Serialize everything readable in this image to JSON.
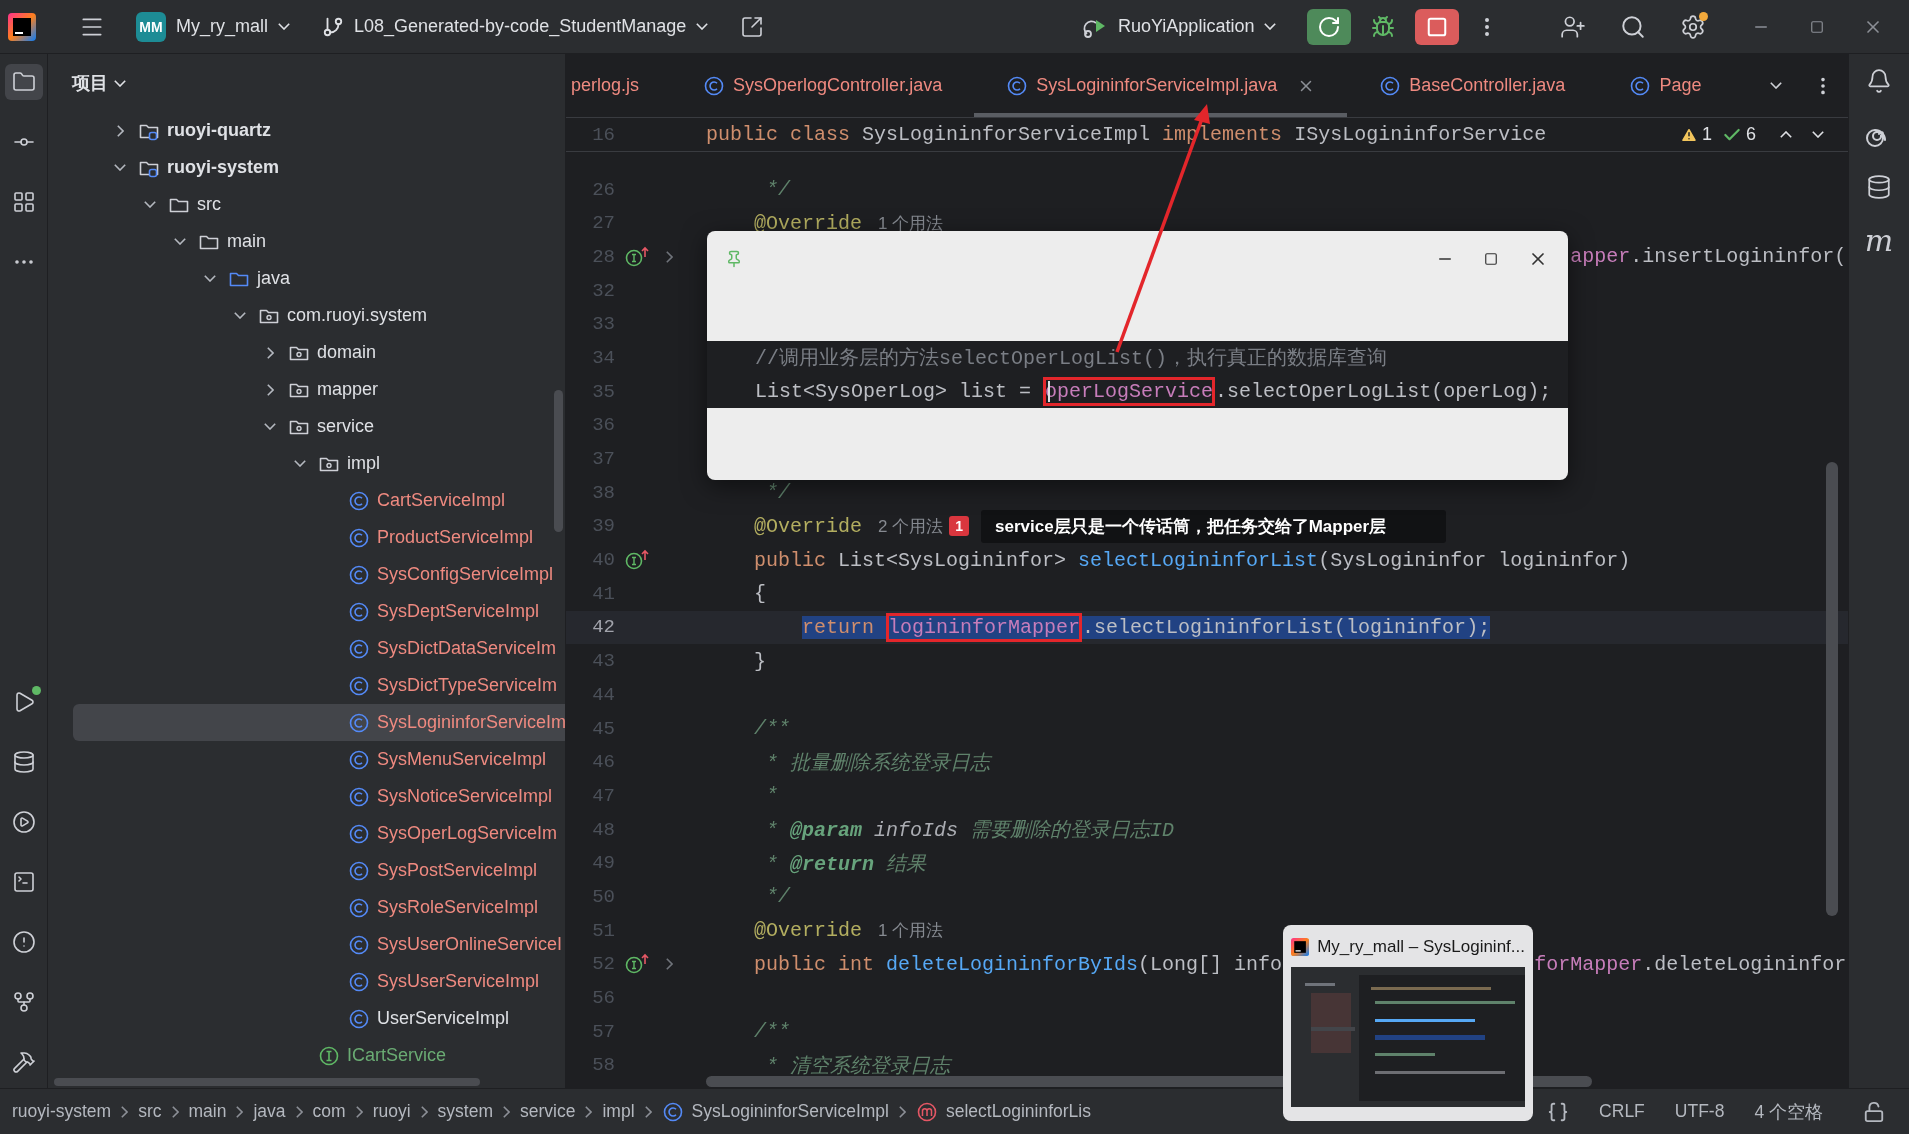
{
  "toolbar": {
    "project_badge": "MM",
    "project": "My_ry_mall",
    "branch": "L08_Generated-by-code_StudentManage",
    "run_config": "RuoYiApplication"
  },
  "left_toolbar": {
    "top": [
      {
        "kind": "project",
        "selected": true,
        "badge": false
      },
      {
        "kind": "commit",
        "selected": false,
        "badge": false
      },
      {
        "kind": "structure",
        "selected": false,
        "badge": false
      },
      {
        "kind": "more",
        "selected": false,
        "badge": false
      }
    ],
    "bottom": [
      {
        "kind": "run",
        "selected": false,
        "badge": true
      },
      {
        "kind": "database",
        "selected": false,
        "badge": false
      },
      {
        "kind": "services",
        "selected": false,
        "badge": false
      },
      {
        "kind": "terminal",
        "selected": false,
        "badge": false
      },
      {
        "kind": "problems",
        "selected": false,
        "badge": false
      },
      {
        "kind": "git",
        "selected": false,
        "badge": false
      },
      {
        "kind": "build",
        "selected": false,
        "badge": false
      }
    ]
  },
  "project_panel": {
    "title": "项目",
    "tree": [
      {
        "label": "ruoyi-quartz",
        "kind": "module",
        "expanded": false,
        "selected": false,
        "color": "#dfe1e5"
      },
      {
        "label": "ruoyi-system",
        "kind": "module",
        "expanded": true,
        "selected": false,
        "color": "#dfe1e5",
        "children": [
          {
            "label": "src",
            "kind": "folder",
            "expanded": true,
            "selected": false,
            "color": "#dfe1e5",
            "children": [
              {
                "label": "main",
                "kind": "folder",
                "expanded": true,
                "selected": false,
                "color": "#dfe1e5",
                "children": [
                  {
                    "label": "java",
                    "kind": "source",
                    "expanded": true,
                    "selected": false,
                    "color": "#dfe1e5",
                    "children": [
                      {
                        "label": "com.ruoyi.system",
                        "kind": "package",
                        "expanded": true,
                        "selected": false,
                        "color": "#dfe1e5",
                        "children": [
                          {
                            "label": "domain",
                            "kind": "package",
                            "expanded": false,
                            "selected": false,
                            "color": "#dfe1e5"
                          },
                          {
                            "label": "mapper",
                            "kind": "package",
                            "expanded": false,
                            "selected": false,
                            "color": "#dfe1e5"
                          },
                          {
                            "label": "service",
                            "kind": "package",
                            "expanded": true,
                            "selected": false,
                            "color": "#dfe1e5",
                            "children": [
                              {
                                "label": "impl",
                                "kind": "package",
                                "expanded": true,
                                "selected": false,
                                "color": "#dfe1e5",
                                "children": [
                                  {
                                    "label": "CartServiceImpl",
                                    "kind": "class",
                                    "selected": false,
                                    "color": "#ef8a80"
                                  },
                                  {
                                    "label": "ProductServiceImpl",
                                    "kind": "class",
                                    "selected": false,
                                    "color": "#ef8a80"
                                  },
                                  {
                                    "label": "SysConfigServiceImpl",
                                    "kind": "class",
                                    "selected": false,
                                    "color": "#ef8a80"
                                  },
                                  {
                                    "label": "SysDeptServiceImpl",
                                    "kind": "class",
                                    "selected": false,
                                    "color": "#ef8a80"
                                  },
                                  {
                                    "label": "SysDictDataServiceIm",
                                    "kind": "class",
                                    "selected": false,
                                    "color": "#ef8a80"
                                  },
                                  {
                                    "label": "SysDictTypeServiceIm",
                                    "kind": "class",
                                    "selected": false,
                                    "color": "#ef8a80"
                                  },
                                  {
                                    "label": "SysLogininforServiceIm",
                                    "kind": "class",
                                    "selected": true,
                                    "color": "#ef8a80"
                                  },
                                  {
                                    "label": "SysMenuServiceImpl",
                                    "kind": "class",
                                    "selected": false,
                                    "color": "#ef8a80"
                                  },
                                  {
                                    "label": "SysNoticeServiceImpl",
                                    "kind": "class",
                                    "selected": false,
                                    "color": "#ef8a80"
                                  },
                                  {
                                    "label": "SysOperLogServiceIm",
                                    "kind": "class",
                                    "selected": false,
                                    "color": "#ef8a80"
                                  },
                                  {
                                    "label": "SysPostServiceImpl",
                                    "kind": "class",
                                    "selected": false,
                                    "color": "#ef8a80"
                                  },
                                  {
                                    "label": "SysRoleServiceImpl",
                                    "kind": "class",
                                    "selected": false,
                                    "color": "#ef8a80"
                                  },
                                  {
                                    "label": "SysUserOnlineServiceI",
                                    "kind": "class",
                                    "selected": false,
                                    "color": "#ef8a80"
                                  },
                                  {
                                    "label": "SysUserServiceImpl",
                                    "kind": "class",
                                    "selected": false,
                                    "color": "#ef8a80"
                                  },
                                  {
                                    "label": "UserServiceImpl",
                                    "kind": "class",
                                    "selected": false,
                                    "color": "#dfe1e5"
                                  }
                                ]
                              },
                              {
                                "label": "ICartService",
                                "kind": "interface",
                                "selected": false,
                                "color": "#6aab73"
                              }
                            ]
                          }
                        ]
                      }
                    ]
                  }
                ]
              }
            ]
          }
        ]
      }
    ]
  },
  "tabs": [
    {
      "label": "perlog.js",
      "kind": "js",
      "selected": false,
      "color": "#ef8a80"
    },
    {
      "label": "SysOperlogController.java",
      "kind": "class",
      "selected": false,
      "color": "#ef8a80"
    },
    {
      "label": "SysLogininforServiceImpl.java",
      "kind": "class",
      "selected": true,
      "color": "#ef8a80"
    },
    {
      "label": "BaseController.java",
      "kind": "class",
      "selected": false,
      "color": "#ef8a80"
    },
    {
      "label": "Page",
      "kind": "class",
      "selected": false,
      "color": "#ef8a80"
    }
  ],
  "sticky_line": {
    "number": "16",
    "tokens": [
      {
        "text": "public class ",
        "kind": "keyword"
      },
      {
        "text": "SysLogininforServiceImpl ",
        "kind": "plain"
      },
      {
        "text": "implements ",
        "kind": "keyword"
      },
      {
        "text": "ISysLogininforService",
        "kind": "plain"
      }
    ]
  },
  "inspections": {
    "warnings": "1",
    "weak_warnings": "6"
  },
  "code_lines": [
    {
      "number": "26",
      "selected": false,
      "foldable": false,
      "implements": false,
      "tokens": [
        {
          "text": "     */",
          "kind": "doc"
        }
      ]
    },
    {
      "number": "27",
      "selected": false,
      "foldable": false,
      "implements": false,
      "tokens": [
        {
          "text": "    @Override",
          "kind": "annotation"
        }
      ],
      "hint": "1 个用法"
    },
    {
      "number": "28",
      "selected": false,
      "foldable": true,
      "implements": true,
      "tail": {
        "kind": "popup",
        "tokens": [
          {
            "text": "apper",
            "kind": "field"
          },
          {
            "text": ".insertLogininfor(",
            "kind": "plain"
          }
        ]
      }
    },
    {
      "number": "32",
      "selected": false,
      "foldable": false,
      "implements": false
    },
    {
      "number": "33",
      "selected": false,
      "foldable": false,
      "implements": false
    },
    {
      "number": "34",
      "selected": false,
      "foldable": false,
      "implements": false
    },
    {
      "number": "35",
      "selected": false,
      "foldable": false,
      "implements": false
    },
    {
      "number": "36",
      "selected": false,
      "foldable": false,
      "implements": false
    },
    {
      "number": "37",
      "selected": false,
      "foldable": false,
      "implements": false
    },
    {
      "number": "38",
      "selected": false,
      "foldable": false,
      "implements": false,
      "tokens": [
        {
          "text": "     */",
          "kind": "doc"
        }
      ]
    },
    {
      "number": "39",
      "selected": false,
      "foldable": false,
      "implements": false,
      "tokens": [
        {
          "text": "    @Override",
          "kind": "annotation"
        }
      ],
      "hint": "2 个用法",
      "badge": "1",
      "callout": "service层只是一个传话筒，把任务交给了Mapper层"
    },
    {
      "number": "40",
      "selected": false,
      "foldable": false,
      "implements": true,
      "tokens": [
        {
          "text": "    public ",
          "kind": "keyword"
        },
        {
          "text": "List<SysLogininfor> ",
          "kind": "plain"
        },
        {
          "text": "selectLogininforList",
          "kind": "method"
        },
        {
          "text": "(SysLogininfor logininfor)",
          "kind": "plain"
        }
      ]
    },
    {
      "number": "41",
      "selected": false,
      "foldable": false,
      "implements": false,
      "tokens": [
        {
          "text": "    {",
          "kind": "plain"
        }
      ]
    },
    {
      "number": "42",
      "selected": true,
      "foldable": false,
      "implements": false,
      "tokens": [
        {
          "text": "        return ",
          "kind": "keyword"
        },
        {
          "text": "logininforMapper",
          "kind": "field",
          "boxed": true
        },
        {
          "text": ".selectLogininforList(logininfor);",
          "kind": "plain"
        }
      ]
    },
    {
      "number": "43",
      "selected": false,
      "foldable": false,
      "implements": false,
      "tokens": [
        {
          "text": "    }",
          "kind": "plain"
        }
      ]
    },
    {
      "number": "44",
      "selected": false,
      "foldable": false,
      "implements": false
    },
    {
      "number": "45",
      "selected": false,
      "foldable": false,
      "implements": false,
      "tokens": [
        {
          "text": "    /**",
          "kind": "doc"
        }
      ]
    },
    {
      "number": "46",
      "selected": false,
      "foldable": false,
      "implements": false,
      "tokens": [
        {
          "text": "     * 批量删除系统登录日志",
          "kind": "doc"
        }
      ]
    },
    {
      "number": "47",
      "selected": false,
      "foldable": false,
      "implements": false,
      "tokens": [
        {
          "text": "     *",
          "kind": "doc"
        }
      ]
    },
    {
      "number": "48",
      "selected": false,
      "foldable": false,
      "implements": false,
      "tokens": [
        {
          "text": "     * ",
          "kind": "doc"
        },
        {
          "text": "@param ",
          "kind": "doctag"
        },
        {
          "text": "infoIds ",
          "kind": "docparam"
        },
        {
          "text": "需要删除的登录日志ID",
          "kind": "doc"
        }
      ]
    },
    {
      "number": "49",
      "selected": false,
      "foldable": false,
      "implements": false,
      "tokens": [
        {
          "text": "     * ",
          "kind": "doc"
        },
        {
          "text": "@return ",
          "kind": "doctag"
        },
        {
          "text": "结果",
          "kind": "doc"
        }
      ]
    },
    {
      "number": "50",
      "selected": false,
      "foldable": false,
      "implements": false,
      "tokens": [
        {
          "text": "     */",
          "kind": "doc"
        }
      ]
    },
    {
      "number": "51",
      "selected": false,
      "foldable": false,
      "implements": false,
      "tokens": [
        {
          "text": "    @Override",
          "kind": "annotation"
        }
      ],
      "hint": "1 个用法"
    },
    {
      "number": "52",
      "selected": false,
      "foldable": true,
      "implements": true,
      "tokens": [
        {
          "text": "    public int ",
          "kind": "keyword"
        },
        {
          "text": "deleteLogininforByIds",
          "kind": "method"
        },
        {
          "text": "(Long[] info",
          "kind": "plain"
        }
      ],
      "tail": {
        "kind": "preview",
        "tokens": [
          {
            "text": "forMapper",
            "kind": "field"
          },
          {
            "text": ".deleteLogininfor",
            "kind": "plain"
          }
        ]
      }
    },
    {
      "number": "56",
      "selected": false,
      "foldable": false,
      "implements": false
    },
    {
      "number": "57",
      "selected": false,
      "foldable": false,
      "implements": false,
      "tokens": [
        {
          "text": "    /**",
          "kind": "doc"
        }
      ]
    },
    {
      "number": "58",
      "selected": false,
      "foldable": false,
      "implements": false,
      "tokens": [
        {
          "text": "     * 清空系统登录日志",
          "kind": "doc"
        }
      ]
    }
  ],
  "popup": {
    "lines": [
      {
        "tokens": [
          {
            "text": "    //调用业务层的方法selectOperLogList()，执行真正的数据库查询",
            "kind": "comment"
          }
        ]
      },
      {
        "tokens": [
          {
            "text": "    List<SysOperLog> list = ",
            "kind": "plain"
          },
          {
            "text": "operLogService",
            "kind": "field",
            "boxed": true,
            "cursor": true
          },
          {
            "text": ".selectOperLogList(operLog);",
            "kind": "plain"
          }
        ]
      }
    ]
  },
  "breadcrumbs": [
    {
      "label": "ruoyi-system",
      "kind": "plain"
    },
    {
      "label": "src",
      "kind": "plain"
    },
    {
      "label": "main",
      "kind": "plain"
    },
    {
      "label": "java",
      "kind": "plain"
    },
    {
      "label": "com",
      "kind": "plain"
    },
    {
      "label": "ruoyi",
      "kind": "plain"
    },
    {
      "label": "system",
      "kind": "plain"
    },
    {
      "label": "service",
      "kind": "plain"
    },
    {
      "label": "impl",
      "kind": "plain"
    },
    {
      "label": "SysLogininforServiceImpl",
      "kind": "class"
    },
    {
      "label": "selectLogininforLis",
      "kind": "method"
    }
  ],
  "status": {
    "line_separator": "CRLF",
    "encoding": "UTF-8",
    "indent": "4 个空格"
  },
  "preview": {
    "title": "My_ry_mall – SysLogininf..."
  },
  "right_toolbar": {
    "maven_label": "m"
  }
}
